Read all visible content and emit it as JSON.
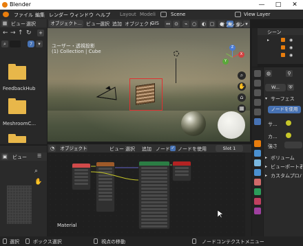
{
  "window": {
    "title": "Blender",
    "min": "—",
    "max": "□",
    "close": "✕"
  },
  "menu": {
    "items": [
      "ファイル",
      "編集",
      "レンダー",
      "ウィンドウ",
      "ヘルプ"
    ],
    "tabs": [
      "Layout",
      "Modeli"
    ],
    "scene": "Scene",
    "viewlayer": "View Layer"
  },
  "filebrowser": {
    "header": {
      "view": "ビュー",
      "select": "選択"
    },
    "path_btn": "7",
    "folders": [
      {
        "label": "FeedbackHub"
      },
      {
        "label": "MeshroomC..."
      },
      {
        "label": ""
      }
    ]
  },
  "viewport_header": {
    "mode": "オブジェクト...",
    "view": "ビュー",
    "select": "選択",
    "add": "追加",
    "object": "オブジェクト",
    "gis": "GIS",
    "global": "グロー...",
    "options": "オプション"
  },
  "viewport": {
    "info_line1": "ユーザー・透視投影",
    "info_line2": "(1) Collection | Cube"
  },
  "gizmo": {
    "x": "X",
    "y": "Y",
    "z": "Z"
  },
  "node_header": {
    "mode": "オブジェクト",
    "view": "ビュー",
    "select": "選択",
    "add": "追加",
    "node": "ノード",
    "use_nodes": "ノードを使用",
    "slot": "Slot 1"
  },
  "node_editor": {
    "material_label": "Material"
  },
  "image_panel": {
    "view": "ビュー"
  },
  "outliner": {
    "title": "シーン"
  },
  "properties": {
    "obj_name": "W...",
    "surface": "サーフェス",
    "use_nodes": "ノードを使用",
    "rows": [
      "サ...",
      "カ...",
      "強さ"
    ],
    "sections": [
      "ボリューム",
      "ビューポート表示",
      "カスタムプロパ..."
    ]
  },
  "status": {
    "select": "選択",
    "box_select": "ボックス選択",
    "view_move": "視点の移動",
    "node_menu": "ノードコンテクストメニュー"
  },
  "colors": {
    "accent": "#4772b3",
    "folder": "#e8b74a",
    "selection": "#e03030",
    "material_node": "#2b7d44",
    "output_node": "#b32323"
  }
}
